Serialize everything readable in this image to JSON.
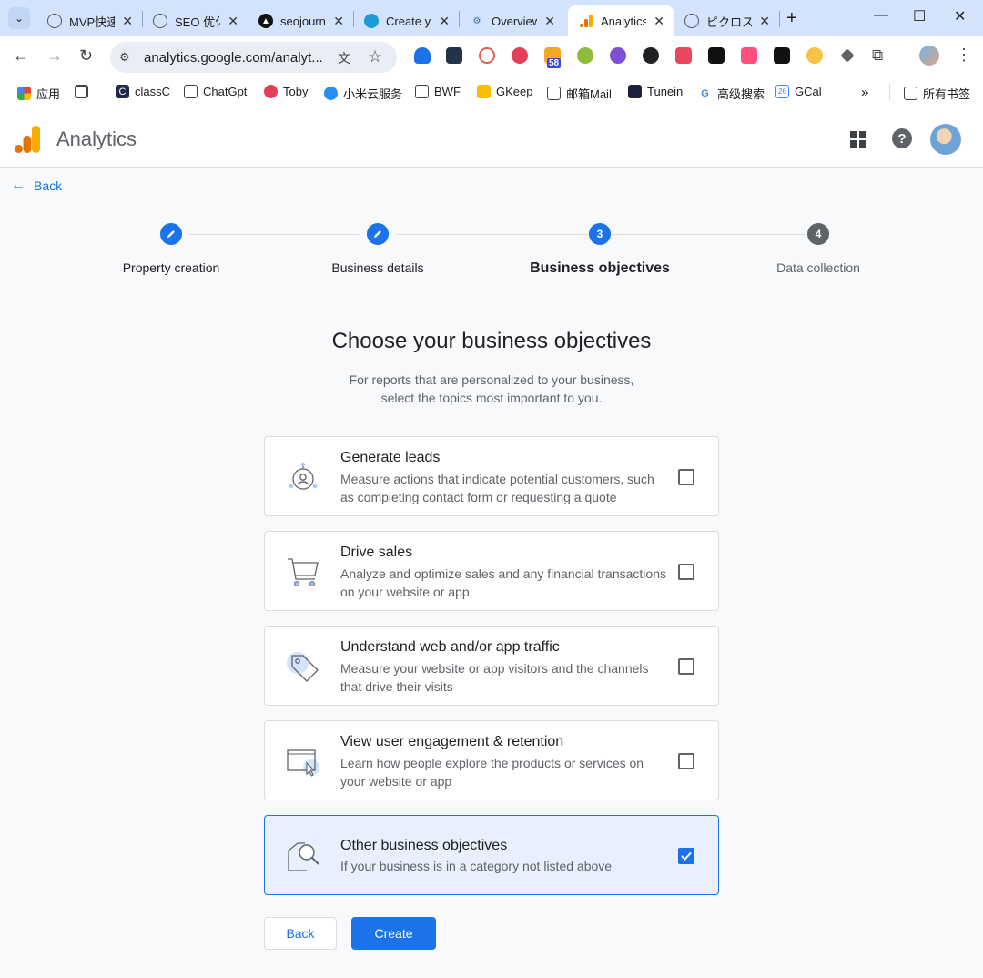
{
  "browser": {
    "tabs": [
      {
        "title": "MVP快速",
        "favicon": "globe-icon"
      },
      {
        "title": "SEO 优化",
        "favicon": "globe-icon"
      },
      {
        "title": "seojourney",
        "favicon": "triangle-icon"
      },
      {
        "title": "Create your",
        "favicon": "cloud-icon"
      },
      {
        "title": "Overview",
        "favicon": "doc-icon"
      },
      {
        "title": "Analytics",
        "favicon": "analytics-icon",
        "active": true
      },
      {
        "title": "ピクロス",
        "favicon": "globe-icon"
      }
    ],
    "url": "analytics.google.com/analyt...",
    "bookmarks": [
      {
        "label": "应用",
        "icon": "apps-grid-icon"
      },
      {
        "label": "",
        "icon": "grid-icon"
      },
      {
        "label": "classC",
        "icon": "classc-icon"
      },
      {
        "label": "ChatGpt",
        "icon": "folder-icon"
      },
      {
        "label": "Toby",
        "icon": "toby-icon"
      },
      {
        "label": "小米云服务",
        "icon": "cloud-icon"
      },
      {
        "label": "BWF",
        "icon": "folder-icon"
      },
      {
        "label": "GKeep",
        "icon": "keep-icon"
      },
      {
        "label": "邮箱Mail",
        "icon": "folder-icon"
      },
      {
        "label": "Tunein",
        "icon": "tunein-icon"
      },
      {
        "label": "高级搜索",
        "icon": "google-icon"
      },
      {
        "label": "GCal",
        "icon": "calendar-icon"
      }
    ],
    "bookmarks_overflow": "»",
    "all_bookmarks": "所有书签",
    "extension_badge": "58"
  },
  "header": {
    "app_title": "Analytics"
  },
  "nav": {
    "back_label": "Back"
  },
  "stepper": {
    "steps": [
      {
        "label": "Property creation",
        "status": "done",
        "marker": ""
      },
      {
        "label": "Business details",
        "status": "done",
        "marker": ""
      },
      {
        "label": "Business objectives",
        "status": "current",
        "marker": "3"
      },
      {
        "label": "Data collection",
        "status": "todo",
        "marker": "4"
      }
    ]
  },
  "page": {
    "heading": "Choose your business objectives",
    "subtext_line1": "For reports that are personalized to your business,",
    "subtext_line2": "select the topics most important to you."
  },
  "objectives": [
    {
      "title": "Generate leads",
      "desc": "Measure actions that indicate potential customers, such as completing contact form or requesting a quote",
      "checked": false,
      "icon": "leads-icon"
    },
    {
      "title": "Drive sales",
      "desc": "Analyze and optimize sales and any financial transactions on your website or app",
      "checked": false,
      "icon": "cart-icon"
    },
    {
      "title": "Understand web and/or app traffic",
      "desc": "Measure your website or app visitors and the channels that drive their visits",
      "checked": false,
      "icon": "tag-icon"
    },
    {
      "title": "View user engagement & retention",
      "desc": "Learn how people explore the products or services on your website or app",
      "checked": false,
      "icon": "screen-cursor-icon"
    },
    {
      "title": "Other business objectives",
      "desc": "If your business is in a category not listed above",
      "checked": true,
      "icon": "magnifier-icon"
    }
  ],
  "actions": {
    "back_label": "Back",
    "create_label": "Create"
  },
  "colors": {
    "accent": "#1a73e8",
    "selected_bg": "#e8f0fe",
    "tabstrip_bg": "#d3e3fd"
  }
}
